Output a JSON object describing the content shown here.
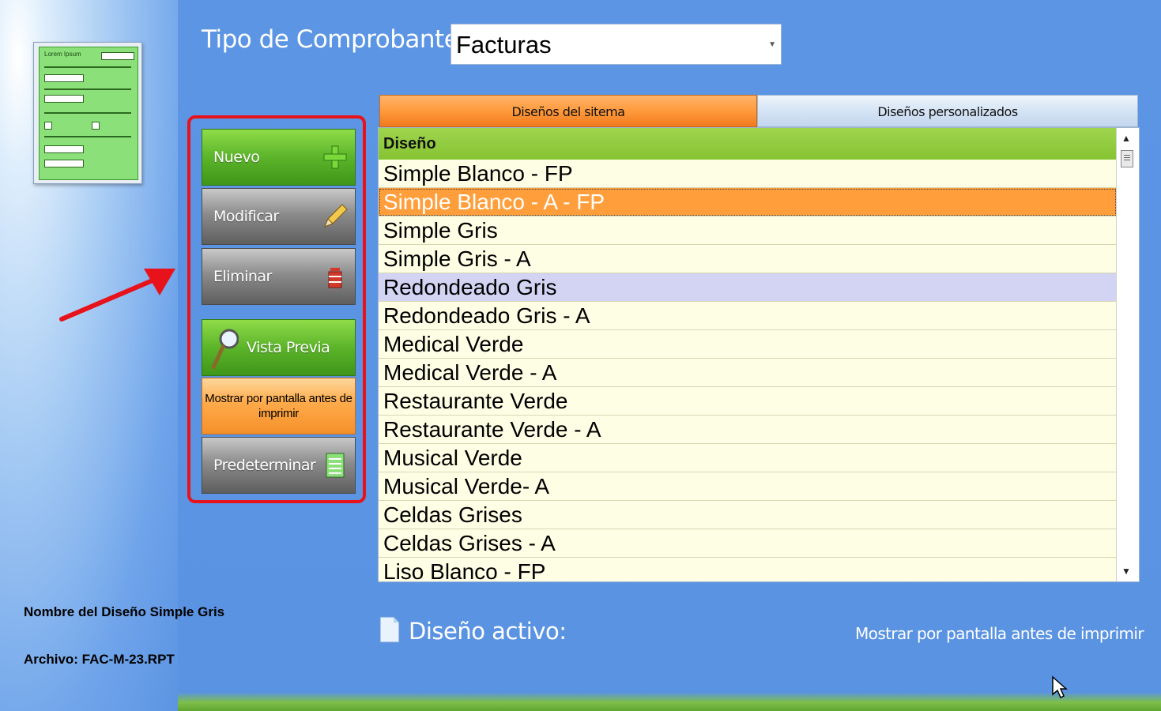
{
  "header": {
    "type_label": "Tipo de Comprobante:",
    "type_value": "Facturas"
  },
  "thumbnail": {
    "heading": "Lorem Ipsum"
  },
  "buttons": {
    "nuevo": "Nuevo",
    "modificar": "Modificar",
    "eliminar": "Eliminar",
    "vista_previa": "Vista Previa",
    "mostrar": "Mostrar por pantalla antes de imprimir",
    "predeterminar": "Predeterminar"
  },
  "tabs": [
    {
      "label": "Diseños del sitema",
      "active": true
    },
    {
      "label": "Diseños personalizados",
      "active": false
    }
  ],
  "grid": {
    "column": "Diseño",
    "rows": [
      "Simple Blanco - FP",
      "Simple Blanco - A - FP",
      "Simple Gris",
      "Simple Gris - A",
      "Redondeado Gris",
      "Redondeado Gris - A",
      "Medical Verde",
      "Medical Verde - A",
      "Restaurante Verde",
      "Restaurante Verde - A",
      "Musical Verde",
      "Musical Verde- A",
      "Celdas Grises",
      "Celdas Grises - A",
      "Liso Blanco - FP"
    ],
    "selected_index": 1,
    "hover_index": 4
  },
  "footer": {
    "design_name": "Nombre del Diseño Simple Gris",
    "file": "Archivo: FAC-M-23.RPT",
    "active_label": "Diseño activo:",
    "show_label": "Mostrar por pantalla antes de imprimir"
  },
  "colors": {
    "accent_orange": "#ff9e3a",
    "highlight_red": "#e8121b",
    "background_blue": "#5b95e4"
  }
}
